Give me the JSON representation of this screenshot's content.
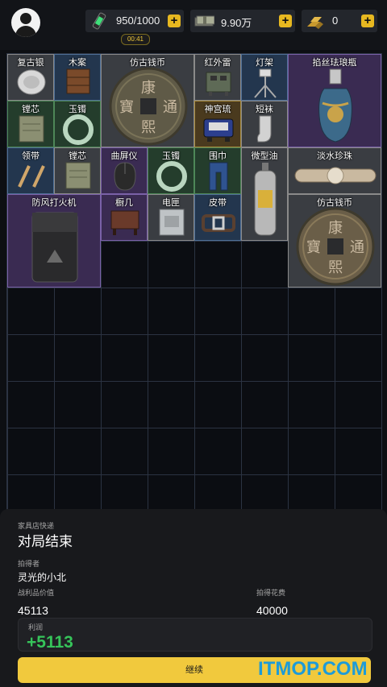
{
  "top": {
    "res1": {
      "value": "950/1000",
      "icon": "syringe-icon"
    },
    "res2": {
      "value": "9.90万",
      "icon": "cash-stack-icon"
    },
    "res3": {
      "value": "0",
      "icon": "gold-bars-icon"
    },
    "plus": "+",
    "timer": "00:41"
  },
  "items": [
    {
      "label": "复古银"
    },
    {
      "label": "木案"
    },
    {
      "label": "仿古钱币"
    },
    {
      "label": "红外雷"
    },
    {
      "label": "灯架"
    },
    {
      "label": "掐丝珐琅瓶"
    },
    {
      "label": "镗芯"
    },
    {
      "label": "玉镯"
    },
    {
      "label": "神宫琉"
    },
    {
      "label": "短袜"
    },
    {
      "label": "领带"
    },
    {
      "label": "镗芯"
    },
    {
      "label": "曲屏仪"
    },
    {
      "label": "玉镯"
    },
    {
      "label": "围巾"
    },
    {
      "label": "微型油"
    },
    {
      "label": "淡水珍珠"
    },
    {
      "label": "防风打火机"
    },
    {
      "label": "橱几"
    },
    {
      "label": "电匣"
    },
    {
      "label": "皮带"
    },
    {
      "label": "仿古钱币"
    }
  ],
  "coin_chars": [
    "康",
    "通",
    "寶",
    "熙"
  ],
  "panel": {
    "subtitle": "家具店快递",
    "title": "对局结束",
    "picker_label": "拍得者",
    "picker_value": "灵光的小北",
    "loot_label": "战利品价值",
    "loot_value": "45113",
    "spend_label": "拍得花费",
    "spend_value": "40000",
    "profit_label": "利润",
    "profit_value": "+5113",
    "continue_label": "继续"
  },
  "watermark": "ITMOP.COM",
  "colors": {
    "accent": "#f1c93d",
    "profit": "#36c45a",
    "watermark": "#1d9bd8"
  }
}
